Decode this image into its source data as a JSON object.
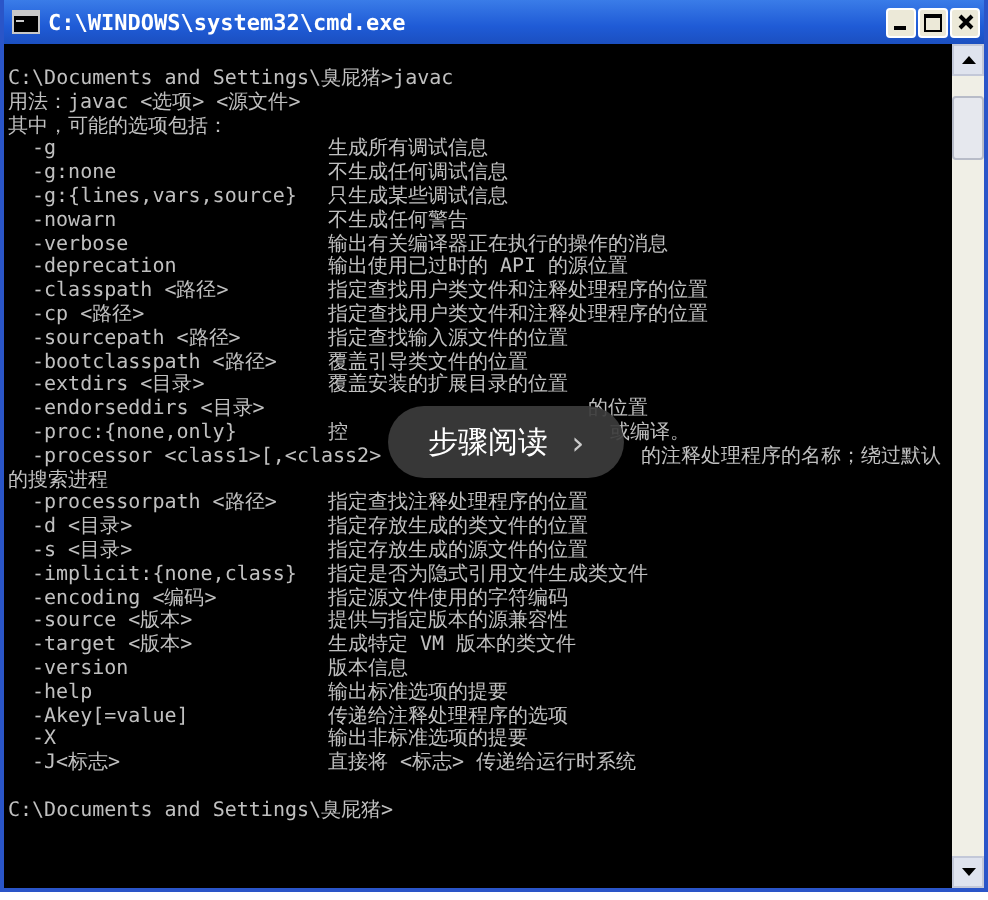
{
  "window": {
    "title": "C:\\WINDOWS\\system32\\cmd.exe"
  },
  "console": {
    "lines": [
      {
        "kind": "text",
        "text": "C:\\Documents and Settings\\臭屁猪>javac"
      },
      {
        "kind": "text",
        "text": "用法：javac <选项> <源文件>"
      },
      {
        "kind": "text",
        "text": "其中，可能的选项包括："
      },
      {
        "kind": "option",
        "option": "-g",
        "description": "生成所有调试信息"
      },
      {
        "kind": "option",
        "option": "-g:none",
        "description": "不生成任何调试信息"
      },
      {
        "kind": "option",
        "option": "-g:{lines,vars,source}",
        "description": "只生成某些调试信息"
      },
      {
        "kind": "option",
        "option": "-nowarn",
        "description": "不生成任何警告"
      },
      {
        "kind": "option",
        "option": "-verbose",
        "description": "输出有关编译器正在执行的操作的消息"
      },
      {
        "kind": "option",
        "option": "-deprecation",
        "description": "输出使用已过时的 API 的源位置"
      },
      {
        "kind": "option",
        "option": "-classpath <路径>",
        "description": "指定查找用户类文件和注释处理程序的位置"
      },
      {
        "kind": "option",
        "option": "-cp <路径>",
        "description": "指定查找用户类文件和注释处理程序的位置"
      },
      {
        "kind": "option",
        "option": "-sourcepath <路径>",
        "description": "指定查找输入源文件的位置"
      },
      {
        "kind": "option",
        "option": "-bootclasspath <路径>",
        "description": "覆盖引导类文件的位置"
      },
      {
        "kind": "option",
        "option": "-extdirs <目录>",
        "description": "覆盖安装的扩展目录的位置"
      },
      {
        "kind": "covered",
        "option": "-endorseddirs <目录>",
        "after": "的位置"
      },
      {
        "kind": "covered",
        "option": "-proc:{none,only}",
        "description": "控",
        "after": "或编译。"
      },
      {
        "kind": "covered",
        "option": "-processor <class1>[,<class2>",
        "after": "的注释处理程序的名称；绕过默认"
      },
      {
        "kind": "text",
        "text": "的搜索进程"
      },
      {
        "kind": "option",
        "option": "-processorpath <路径>",
        "description": "指定查找注释处理程序的位置"
      },
      {
        "kind": "option",
        "option": "-d <目录>",
        "description": "指定存放生成的类文件的位置"
      },
      {
        "kind": "option",
        "option": "-s <目录>",
        "description": "指定存放生成的源文件的位置"
      },
      {
        "kind": "option",
        "option": "-implicit:{none,class}",
        "description": "指定是否为隐式引用文件生成类文件"
      },
      {
        "kind": "option",
        "option": "-encoding <编码>",
        "description": "指定源文件使用的字符编码"
      },
      {
        "kind": "option",
        "option": "-source <版本>",
        "description": "提供与指定版本的源兼容性"
      },
      {
        "kind": "option",
        "option": "-target <版本>",
        "description": "生成特定 VM 版本的类文件"
      },
      {
        "kind": "option",
        "option": "-version",
        "description": "版本信息"
      },
      {
        "kind": "option",
        "option": "-help",
        "description": "输出标准选项的提要"
      },
      {
        "kind": "option",
        "option": "-Akey[=value]",
        "description": "传递给注释处理程序的选项"
      },
      {
        "kind": "option",
        "option": "-X",
        "description": "输出非标准选项的提要"
      },
      {
        "kind": "option",
        "option": "-J<标志>",
        "description": "直接将 <标志> 传递给运行时系统"
      },
      {
        "kind": "blank"
      },
      {
        "kind": "text",
        "text": "C:\\Documents and Settings\\臭屁猪>"
      }
    ]
  },
  "overlay_button": {
    "label": "步骤阅读",
    "arrow": "›"
  }
}
